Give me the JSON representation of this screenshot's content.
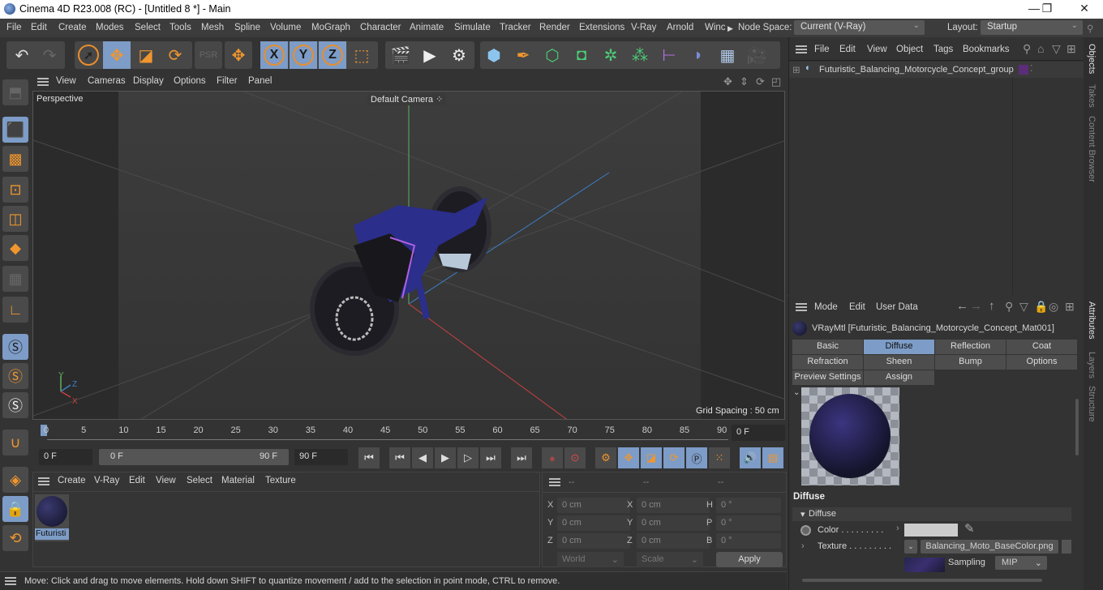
{
  "window": {
    "title": "Cinema 4D R23.008 (RC) - [Untitled 8 *] - Main",
    "minimize": "—",
    "maximize": "❐",
    "close": "✕"
  },
  "menubar": {
    "items": [
      "File",
      "Edit",
      "Create",
      "Modes",
      "Select",
      "Tools",
      "Mesh",
      "Spline",
      "Volume",
      "MoGraph",
      "Character",
      "Animate",
      "Simulate",
      "Tracker",
      "Render",
      "Extensions",
      "V-Ray",
      "Arnold",
      "Winc"
    ],
    "node_space_label": "Node Space:",
    "node_space_value": "Current (V-Ray)",
    "layout_label": "Layout:",
    "layout_value": "Startup"
  },
  "toolbar": {
    "tools": [
      "undo",
      "redo",
      "live-selection",
      "move",
      "scale",
      "rotate",
      "psr",
      "move-axis",
      "x-axis",
      "y-axis",
      "z-axis",
      "coordinate-system",
      "render-view",
      "render-picture-viewer",
      "render-settings",
      "cube",
      "pen",
      "subdivision",
      "extrude",
      "cloner",
      "instances",
      "bend-deformer",
      "deformer",
      "floor",
      "camera"
    ],
    "x_label": "X",
    "y_label": "Y",
    "z_label": "Z"
  },
  "viewport": {
    "menu": [
      "View",
      "Cameras",
      "Display",
      "Options",
      "Filter",
      "Panel"
    ],
    "view_name": "Perspective",
    "camera_name": "Default Camera",
    "grid_spacing": "Grid Spacing : 50 cm",
    "axis_labels": {
      "x": "X",
      "y": "Y",
      "z": "Z"
    }
  },
  "timeline": {
    "ticks": [
      "0",
      "5",
      "10",
      "15",
      "20",
      "25",
      "30",
      "35",
      "40",
      "45",
      "50",
      "55",
      "60",
      "65",
      "70",
      "75",
      "80",
      "85",
      "90"
    ],
    "current_frame": "0 F",
    "start_frame": "0 F",
    "range_start": "0 F",
    "range_end": "90 F",
    "end_frame": "90 F"
  },
  "material_manager": {
    "menu": [
      "Create",
      "V-Ray",
      "Edit",
      "View",
      "Select",
      "Material",
      "Texture"
    ],
    "materials": [
      {
        "name": "Futuristi"
      }
    ]
  },
  "coordinates": {
    "headers": [
      "--",
      "--",
      "--"
    ],
    "rows": [
      {
        "l1": "X",
        "v1": "0 cm",
        "l2": "X",
        "v2": "0 cm",
        "l3": "H",
        "v3": "0 °"
      },
      {
        "l1": "Y",
        "v1": "0 cm",
        "l2": "Y",
        "v2": "0 cm",
        "l3": "P",
        "v3": "0 °"
      },
      {
        "l1": "Z",
        "v1": "0 cm",
        "l2": "Z",
        "v2": "0 cm",
        "l3": "B",
        "v3": "0 °"
      }
    ],
    "space": "World",
    "mode": "Scale",
    "apply": "Apply"
  },
  "statusbar": {
    "text": "Move: Click and drag to move elements. Hold down SHIFT to quantize movement / add to the selection in point mode, CTRL to remove."
  },
  "objects_panel": {
    "menu": [
      "File",
      "Edit",
      "View",
      "Object",
      "Tags",
      "Bookmarks"
    ],
    "objects": [
      {
        "name": "Futuristic_Balancing_Motorcycle_Concept_group",
        "tag_color": "#5c2d7a"
      }
    ]
  },
  "attributes_panel": {
    "menu": [
      "Mode",
      "Edit",
      "User Data"
    ],
    "material_title": "VRayMtl [Futuristic_Balancing_Motorcycle_Concept_Mat001]",
    "tabs": [
      "Basic",
      "Diffuse",
      "Reflection",
      "Coat",
      "Refraction",
      "Sheen",
      "Bump",
      "Options",
      "Preview Settings",
      "Assign"
    ],
    "active_tab": "Diffuse",
    "section_title": "Diffuse",
    "group_title": "Diffuse",
    "color_label": "Color . . . . . . . . .",
    "color_value": "#cccccc",
    "texture_label": "Texture . . . . . . . . .",
    "texture_file": "Balancing_Moto_BaseColor.png",
    "sampling_label": "Sampling",
    "sampling_value": "MIP"
  },
  "side_tabs": {
    "top": [
      "Objects",
      "Takes",
      "Content Browser"
    ],
    "bottom": [
      "Attributes",
      "Layers",
      "Structure"
    ]
  },
  "colors": {
    "accent_selected": "#7d9cc7",
    "tool_orange": "#f0962e",
    "panel_bg": "#333333"
  }
}
